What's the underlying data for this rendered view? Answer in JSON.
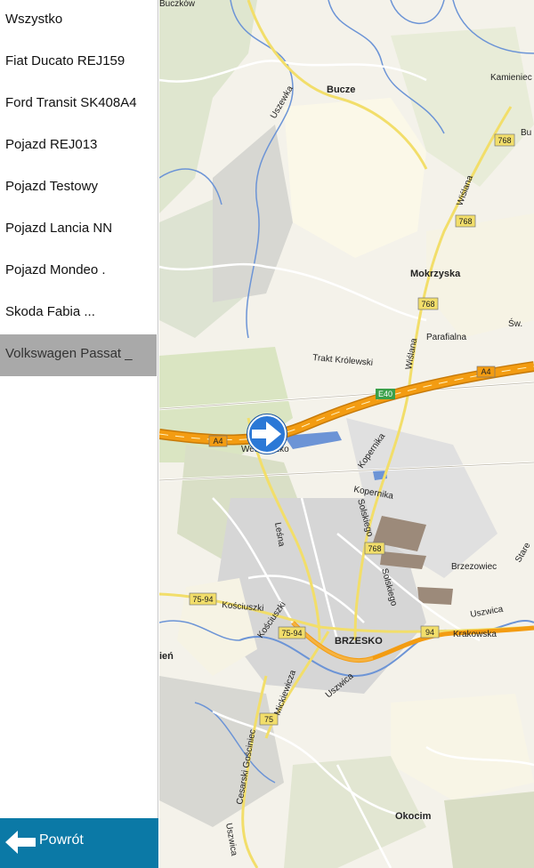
{
  "sidebar": {
    "vehicles": [
      {
        "label": "Wszystko"
      },
      {
        "label": "Fiat Ducato REJ159"
      },
      {
        "label": "Ford Transit SK408A4"
      },
      {
        "label": "Pojazd REJ013"
      },
      {
        "label": "Pojazd Testowy"
      },
      {
        "label": "Pojazd Lancia NN"
      },
      {
        "label": "Pojazd Mondeo ."
      },
      {
        "label": "Skoda Fabia ..."
      },
      {
        "label": "Volkswagen Passat _"
      }
    ],
    "selected_index": 8,
    "back_label": "Powrót"
  },
  "map": {
    "places": {
      "buczkow": "Buczków",
      "bucze": "Bucze",
      "kamieniec": "Kamieniec",
      "bu": "Bu",
      "mokrzyska": "Mokrzyska",
      "parafialna": "Parafialna",
      "sw": "Św.",
      "trakt": "Trakt Królewski",
      "wiesla": "Wiślana",
      "wiesla2": "Wiślana",
      "uszewka": "Uszewka",
      "wesoleszko": "Wesoleszko",
      "kopernika": "Kopernika",
      "kopernika2": "Kopernika",
      "solskiego": "Solskiego",
      "solskiego2": "Solskiego",
      "lesna": "Leśna",
      "kosciuszki": "Kościuszki",
      "kosciuszki2": "Kościuszki",
      "brzesko": "BRZESKO",
      "brzezowiec": "Brzezowiec",
      "uszwica": "Uszwica",
      "uszwica2": "Uszwica",
      "uszwica3": "Uszwica",
      "krakowska": "Krakowska",
      "mickiewicza": "Mickiewicza",
      "gosciniec": "Cesarski Gościniec",
      "okocim": "Okocim",
      "ien": "ień",
      "stare": "Stare"
    },
    "shields": {
      "r768a": "768",
      "r768b": "768",
      "r768c": "768",
      "r768d": "768",
      "e40": "E40",
      "a4a": "A4",
      "a4b": "A4",
      "r7594a": "75-94",
      "r7594b": "75-94",
      "r94": "94",
      "r75": "75"
    },
    "colors": {
      "motorway": "#f39c12",
      "regional": "#f2de6a",
      "water": "#6c94d6",
      "forest": "#cfe0b0",
      "urban": "#d6d6d6",
      "marker": "#2b78d6"
    },
    "marker_icon": "direction-arrow-icon"
  }
}
